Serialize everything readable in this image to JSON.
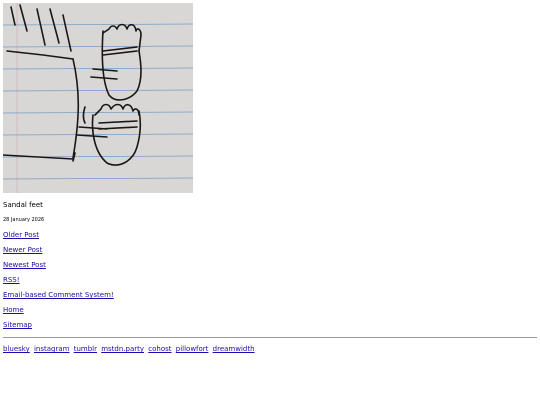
{
  "post": {
    "caption": "Sandal feet",
    "date": "28 January 2026"
  },
  "nav": {
    "items": [
      {
        "label": "Older Post"
      },
      {
        "label": "Newer Post"
      },
      {
        "label": "Newest Post"
      },
      {
        "label": "RSS!"
      },
      {
        "label": "Email-based Comment System!"
      },
      {
        "label": "Home"
      },
      {
        "label": "Sitemap"
      }
    ]
  },
  "social": {
    "links": [
      {
        "label": "bluesky"
      },
      {
        "label": "instagram"
      },
      {
        "label": "tumblr"
      },
      {
        "label": "mstdn.party"
      },
      {
        "label": "cohost"
      },
      {
        "label": "pillowfort"
      },
      {
        "label": "dreamwidth"
      }
    ]
  },
  "colors": {
    "link": "#1a0dab",
    "paper": "#d9d7d5",
    "ruled_line": "#5b8fc4",
    "ink": "#1b1613"
  }
}
